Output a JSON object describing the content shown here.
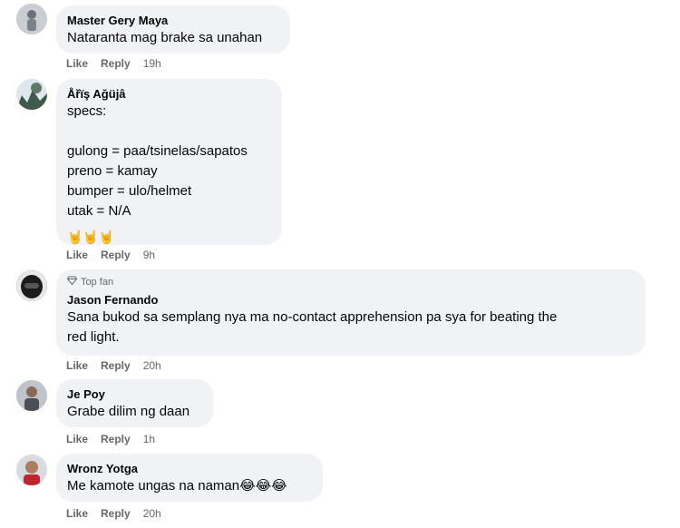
{
  "comments": [
    {
      "name": "Master Gery Maya",
      "text": "Nataranta mag brake sa unahan",
      "like": "Like",
      "reply": "Reply",
      "time": "19h"
    },
    {
      "name": "Åřïş Ağüjâ",
      "text": "specs:\n\ngulong = paa/tsinelas/sapatos\npreno = kamay\nbumper = ulo/helmet\nutak = N/A",
      "reaction": "🤘🤘🤘",
      "like": "Like",
      "reply": "Reply",
      "time": "9h"
    },
    {
      "badge": "Top fan",
      "name": "Jason Fernando",
      "text": "Sana bukod sa semplang nya ma no-contact apprehension pa sya for beating the\nred light.",
      "like": "Like",
      "reply": "Reply",
      "time": "20h"
    },
    {
      "name": "Je Poy",
      "text": "Grabe dilim ng daan",
      "like": "Like",
      "reply": "Reply",
      "time": "1h"
    },
    {
      "name": "Wronz Yotga",
      "text": "Me kamote ungas na naman😂😂😂",
      "like": "Like",
      "reply": "Reply",
      "time": "20h"
    }
  ]
}
